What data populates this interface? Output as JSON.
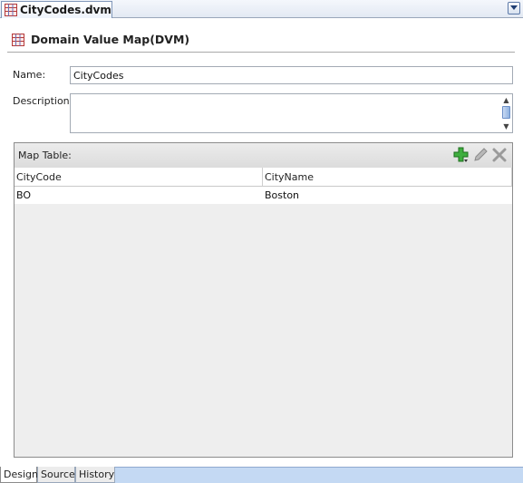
{
  "file_tab": {
    "label": "CityCodes.dvm",
    "icon": "dvm-grid-icon"
  },
  "editor": {
    "title": "Domain Value Map(DVM)",
    "name_label": "Name:",
    "name_value": "CityCodes",
    "description_label": "Description:",
    "description_value": ""
  },
  "map_table": {
    "label": "Map Table:",
    "columns": [
      "CityCode",
      "CityName"
    ],
    "rows": [
      [
        "BO",
        "Boston"
      ]
    ]
  },
  "bottom_tabs": [
    {
      "label": "Design",
      "active": true
    },
    {
      "label": "Source",
      "active": false
    },
    {
      "label": "History",
      "active": false
    }
  ],
  "colors": {
    "add_icon": "#2fa12f",
    "tab_bar": "#c4d9f3"
  }
}
